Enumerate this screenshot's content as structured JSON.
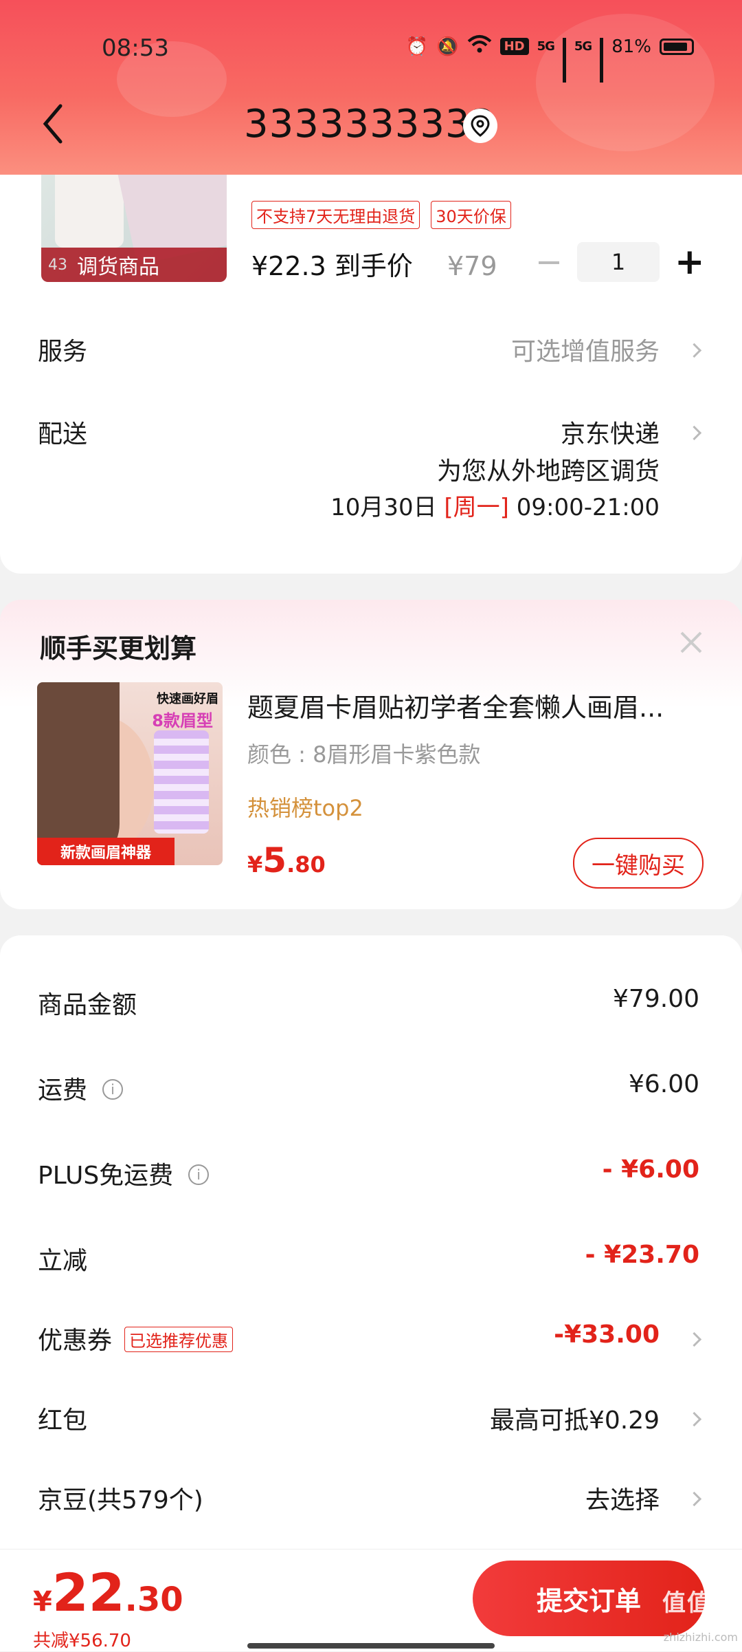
{
  "status_bar": {
    "time": "08:53",
    "hd": "HD",
    "net1": "5G",
    "net2": "5G",
    "battery": "81%"
  },
  "header": {
    "title": "3333333333"
  },
  "product": {
    "image_tag": "调货商品",
    "image_num": "43",
    "labels": [
      "不支持7天无理由退货",
      "30天价保"
    ],
    "price": "¥22.3",
    "price_suffix": "到手价",
    "orig_price": "¥79",
    "quantity": "1"
  },
  "service": {
    "label": "服务",
    "value": "可选增值服务"
  },
  "delivery": {
    "label": "配送",
    "carrier": "京东快递",
    "note": "为您从外地跨区调货",
    "date": "10月30日",
    "weekday": "[周一]",
    "time": "09:00-21:00"
  },
  "upsell": {
    "title": "顺手买更划算",
    "name": "题夏眉卡眉贴初学者全套懒人画眉...",
    "color": "颜色 : 8眉形眉卡紫色款",
    "hot": "热销榜top2",
    "price_cur": "¥",
    "price_int": "5",
    "price_dec": ".80",
    "button": "一键购买",
    "img_text1": "快速画好眉",
    "img_text2": "8款眉型",
    "img_text3": "新款画眉神器"
  },
  "summary": {
    "goods": {
      "label": "商品金额",
      "value": "¥79.00"
    },
    "shipping": {
      "label": "运费",
      "value": "¥6.00"
    },
    "plus": {
      "label": "PLUS免运费",
      "value": "- ¥6.00"
    },
    "discount": {
      "label": "立减",
      "value": "- ¥23.70"
    },
    "coupon": {
      "label": "优惠券",
      "tag": "已选推荐优惠",
      "value": "-¥33.00"
    },
    "redpacket": {
      "label": "红包",
      "value": "最高可抵¥0.29"
    },
    "beans": {
      "label": "京豆(共579个)",
      "value": "去选择"
    }
  },
  "footer": {
    "cur": "¥",
    "int": "22",
    "dec": ".30",
    "saved": "共减¥56.70",
    "submit": "提交订单",
    "watermark": "值值值",
    "watermark_url": "zhizhizhi.com"
  }
}
